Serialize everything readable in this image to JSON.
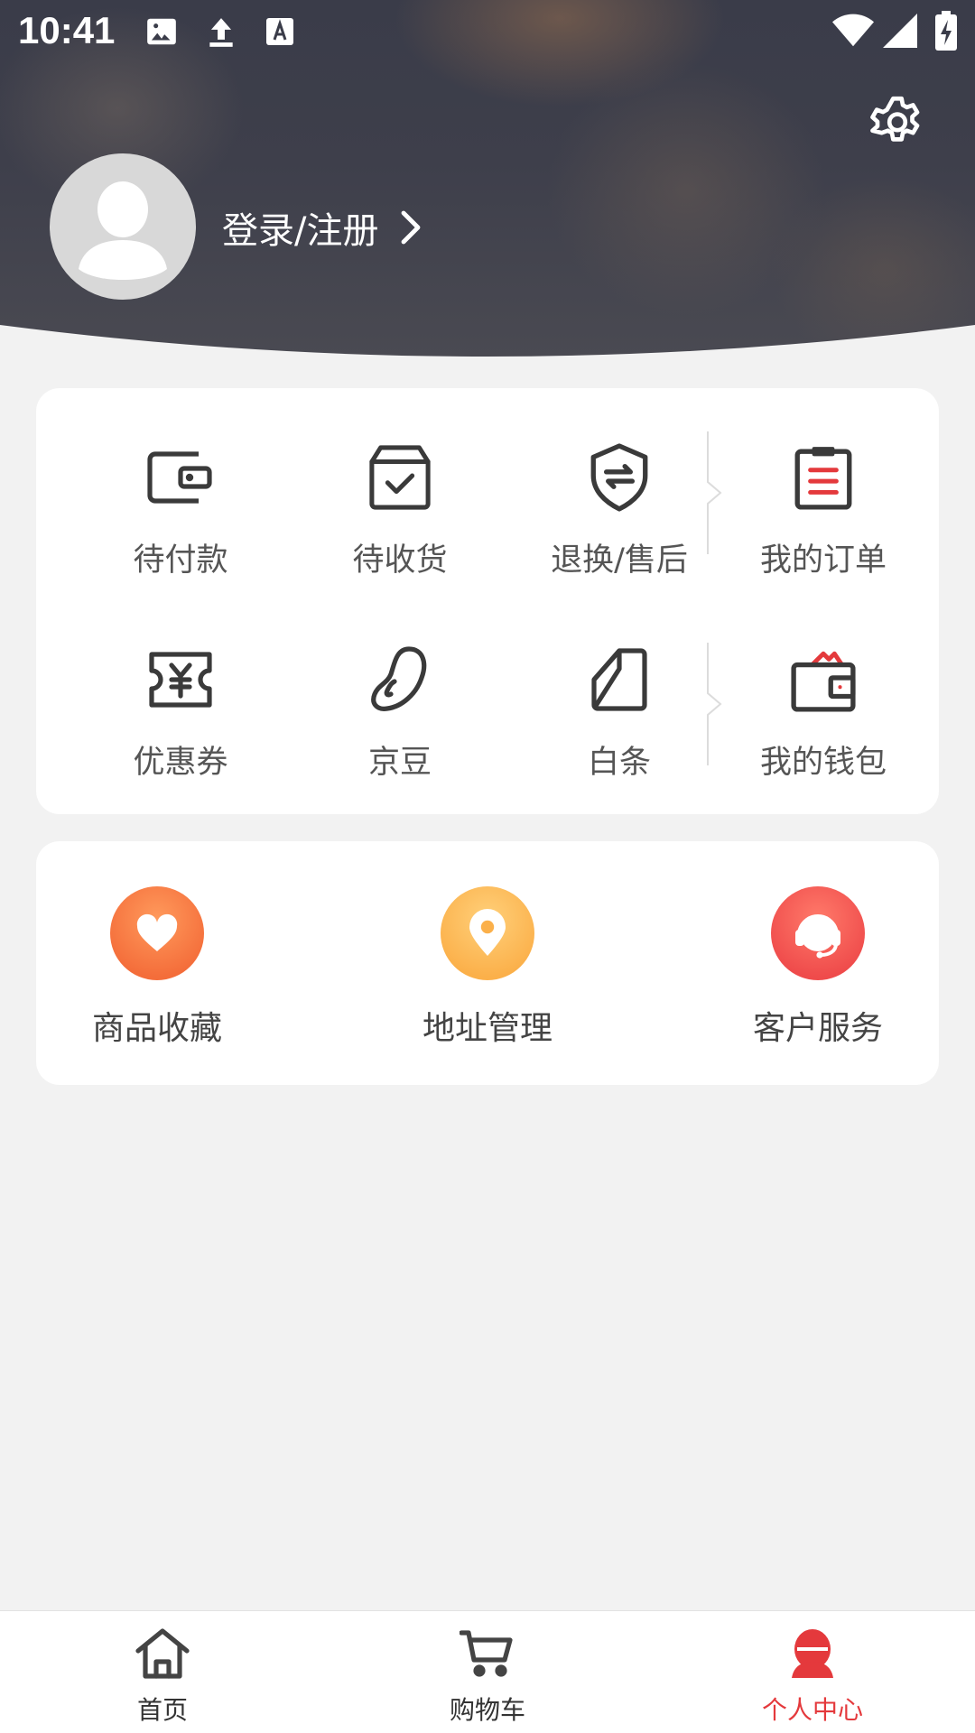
{
  "status_bar": {
    "time": "10:41",
    "notification_icons": [
      "image-icon",
      "upload-icon",
      "text-a-icon"
    ],
    "system_icons": [
      "wifi-icon",
      "cellular-signal-icon",
      "battery-charging-icon"
    ]
  },
  "header": {
    "settings_icon": "gear-icon",
    "avatar_icon": "default-user-avatar-icon",
    "login_label": "登录/注册",
    "login_chevron_icon": "chevron-right-icon"
  },
  "orders_card": {
    "row1": [
      {
        "label": "待付款",
        "icon": "wallet-icon"
      },
      {
        "label": "待收货",
        "icon": "box-check-icon"
      },
      {
        "label": "退换/售后",
        "icon": "shield-exchange-icon"
      },
      {
        "label": "我的订单",
        "icon": "clipboard-list-icon"
      }
    ],
    "row2": [
      {
        "label": "优惠券",
        "icon": "yen-coupon-icon"
      },
      {
        "label": "京豆",
        "icon": "bean-icon"
      },
      {
        "label": "白条",
        "icon": "note-icon"
      },
      {
        "label": "我的钱包",
        "icon": "wallet-cash-icon"
      }
    ]
  },
  "services_card": {
    "items": [
      {
        "label": "商品收藏",
        "icon": "heart-icon",
        "color": "#f46d3a"
      },
      {
        "label": "地址管理",
        "icon": "location-pin-icon",
        "color": "#fbb04a"
      },
      {
        "label": "客户服务",
        "icon": "headset-icon",
        "color": "#ef4b4b"
      }
    ]
  },
  "bottom_nav": {
    "items": [
      {
        "label": "首页",
        "icon": "home-icon",
        "active": false
      },
      {
        "label": "购物车",
        "icon": "cart-icon",
        "active": false
      },
      {
        "label": "个人中心",
        "icon": "user-icon",
        "active": true
      }
    ],
    "active_color": "#e4393c"
  }
}
